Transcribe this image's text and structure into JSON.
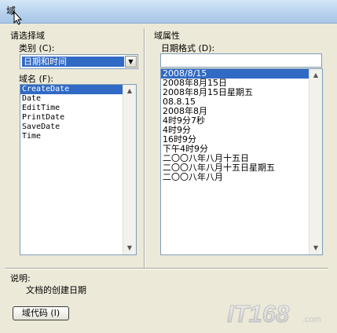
{
  "window": {
    "title": "域"
  },
  "left": {
    "group_label": "请选择域",
    "category_label": "类别 (C):",
    "category_value": "日期和时间",
    "field_names_label": "域名 (F):",
    "field_names": [
      "CreateDate",
      "Date",
      "EditTime",
      "PrintDate",
      "SaveDate",
      "Time"
    ],
    "selected_index": 0
  },
  "right": {
    "group_label": "域属性",
    "date_format_label": "日期格式 (D):",
    "date_format_value": "",
    "formats": [
      "2008/8/15",
      "2008年8月15日",
      "2008年8月15日星期五",
      "08.8.15",
      "2008年8月",
      "4时9分7秒",
      "4时9分",
      "16时9分",
      "下午4时9分",
      "二〇〇八年八月十五日",
      "二〇〇八年八月十五日星期五",
      "二〇〇八年八月"
    ],
    "selected_index": 0
  },
  "description": {
    "label": "说明:",
    "text": "文档的创建日期"
  },
  "buttons": {
    "field_codes": "域代码 (I)"
  },
  "watermark": {
    "text": "IT168",
    "sub": ".com"
  }
}
